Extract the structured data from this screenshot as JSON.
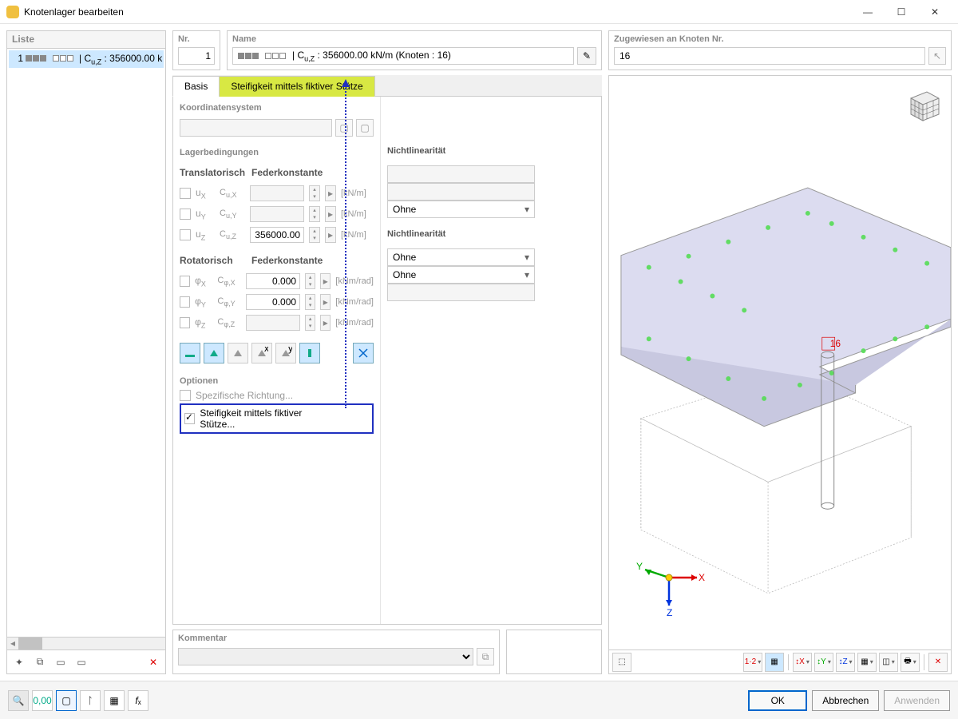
{
  "window": {
    "title": "Knotenlager bearbeiten"
  },
  "list": {
    "header": "Liste",
    "item": "1  ▪▪▪ ▫▫▫ | Cu,Z : 356000.00 k..."
  },
  "nr": {
    "label": "Nr.",
    "value": "1"
  },
  "name": {
    "label": "Name",
    "value": "▪▪▪ ▫▫▫ | Cu,Z : 356000.00 kN/m (Knoten : 16)"
  },
  "assigned": {
    "label": "Zugewiesen an Knoten Nr.",
    "value": "16"
  },
  "tabs": {
    "basis": "Basis",
    "stiff": "Steifigkeit mittels fiktiver Stütze"
  },
  "coord": {
    "label": "Koordinatensystem"
  },
  "support": {
    "label": "Lagerbedingungen",
    "trans_hdr": "Translatorisch",
    "feder_hdr": "Federkonstante",
    "nonlin_hdr": "Nichtlinearität",
    "rot_hdr": "Rotatorisch",
    "rows_trans": [
      {
        "var": "uX",
        "const": "Cu,X",
        "val": "",
        "unit": "[kN/m]",
        "enabled": false,
        "nl": ""
      },
      {
        "var": "uY",
        "const": "Cu,Y",
        "val": "",
        "unit": "[kN/m]",
        "enabled": false,
        "nl": ""
      },
      {
        "var": "uZ",
        "const": "Cu,Z",
        "val": "356000.00",
        "unit": "[kN/m]",
        "enabled": true,
        "nl": "Ohne"
      }
    ],
    "rows_rot": [
      {
        "var": "φX",
        "const": "Cφ,X",
        "val": "0.000",
        "unit": "[kNm/rad]",
        "enabled": true,
        "nl": "Ohne"
      },
      {
        "var": "φY",
        "const": "Cφ,Y",
        "val": "0.000",
        "unit": "[kNm/rad]",
        "enabled": true,
        "nl": "Ohne"
      },
      {
        "var": "φZ",
        "const": "Cφ,Z",
        "val": "",
        "unit": "[kNm/rad]",
        "enabled": false,
        "nl": ""
      }
    ]
  },
  "options": {
    "label": "Optionen",
    "specific": "Spezifische Richtung...",
    "stiff": "Steifigkeit mittels fiktiver Stütze..."
  },
  "comment": {
    "label": "Kommentar"
  },
  "viewport": {
    "node_label": "16",
    "axes": {
      "x": "X",
      "y": "Y",
      "z": "Z"
    }
  },
  "buttons": {
    "ok": "OK",
    "cancel": "Abbrechen",
    "apply": "Anwenden"
  }
}
